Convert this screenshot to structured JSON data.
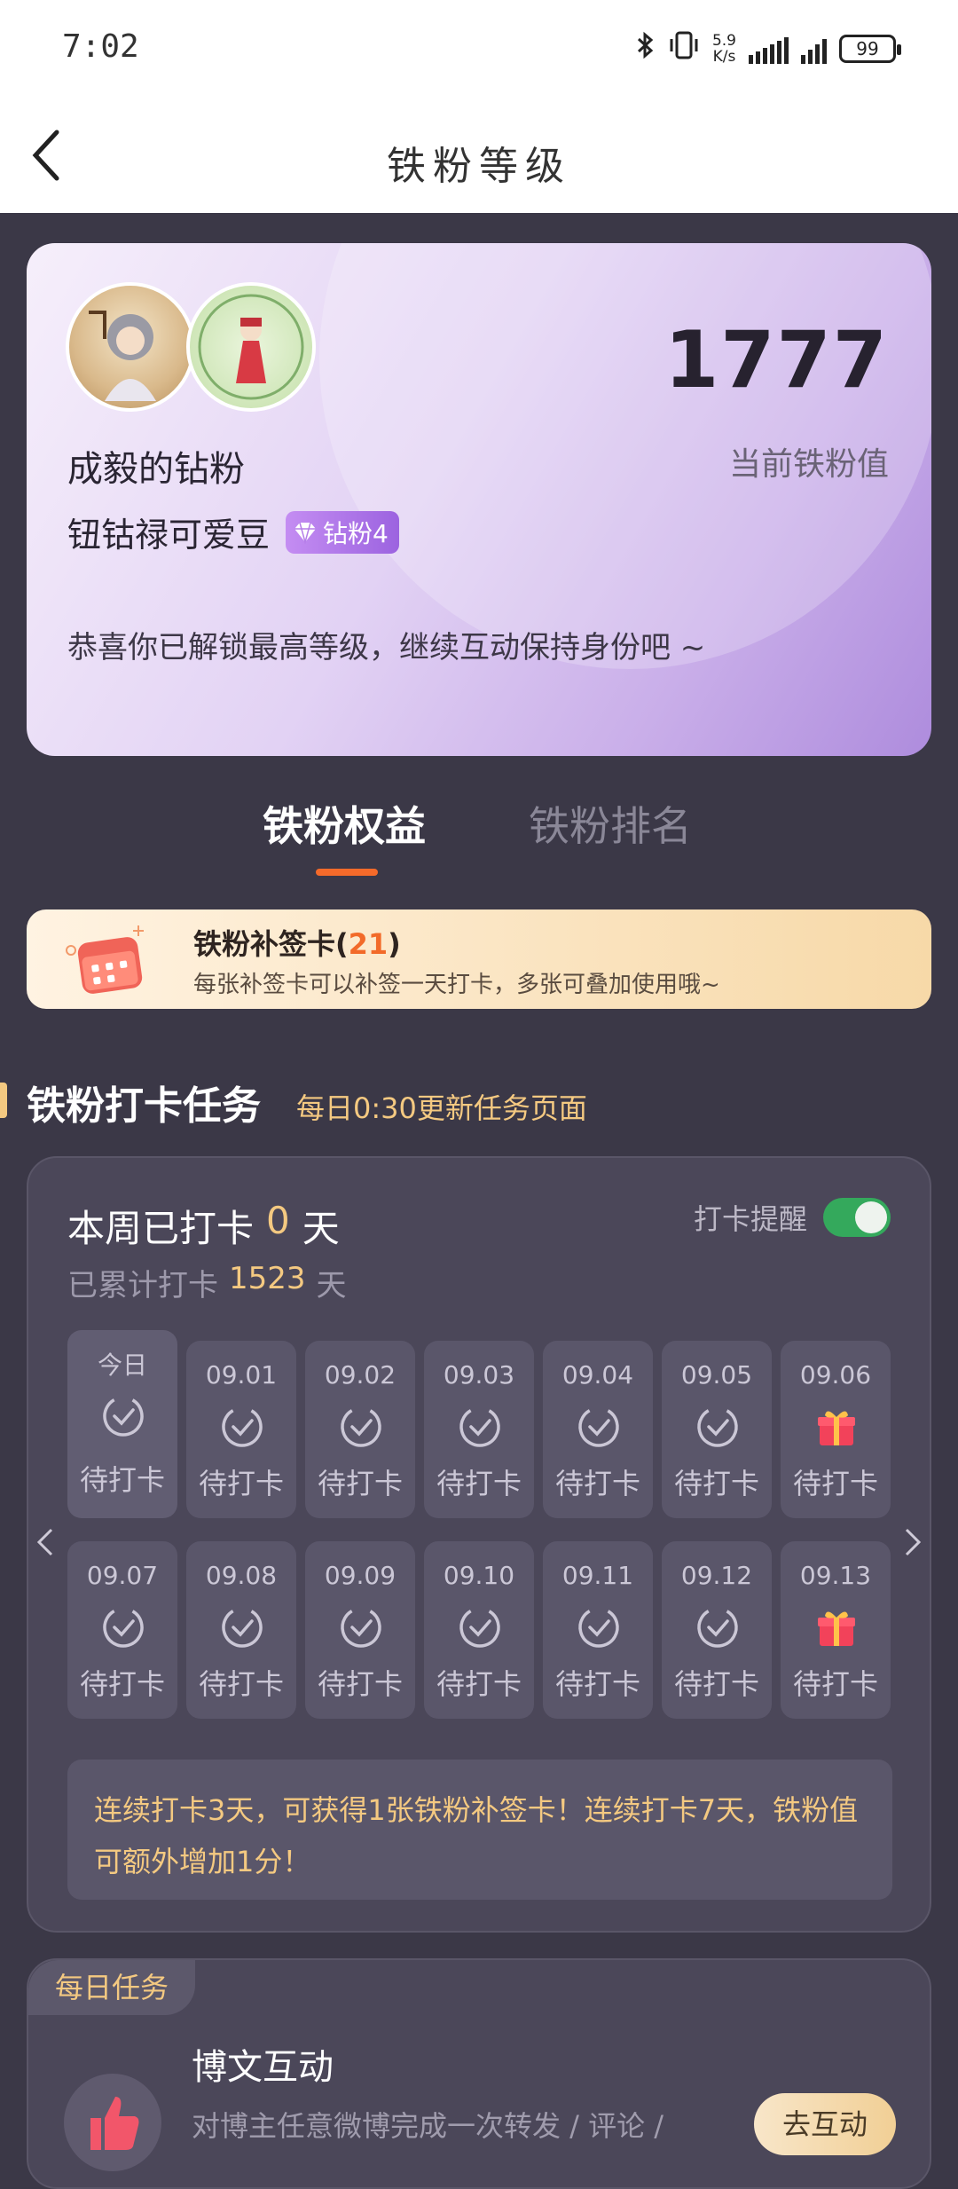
{
  "status_bar": {
    "time": "7:02",
    "net_speed_value": "5.9",
    "net_speed_unit": "K/s",
    "battery": "99"
  },
  "nav": {
    "title": "铁粉等级"
  },
  "profile": {
    "fan_group": "成毅的钻粉",
    "user_name": "钮钴禄可爱豆",
    "badge_label": "钻粉4",
    "score": "1777",
    "score_label": "当前铁粉值",
    "congrats": "恭喜你已解锁最高等级，继续互动保持身份吧 ~"
  },
  "tabs": [
    {
      "label": "铁粉权益",
      "active": true
    },
    {
      "label": "铁粉排名",
      "active": false
    }
  ],
  "makeup_card": {
    "title": "铁粉补签卡",
    "count": "21",
    "description": "每张补签卡可以补签一天打卡，多张可叠加使用哦~"
  },
  "checkin_section": {
    "title": "铁粉打卡任务",
    "subtitle": "每日0:30更新任务页面"
  },
  "checkin": {
    "week_prefix": "本周已打卡",
    "week_count": "0",
    "week_suffix": "天",
    "total_prefix": "已累计打卡",
    "total_count": "1523",
    "total_suffix": "天",
    "remind_label": "打卡提醒",
    "remind_on": true,
    "days": [
      {
        "date": "今日",
        "status": "待打卡",
        "icon": "check-icon"
      },
      {
        "date": "09.01",
        "status": "待打卡",
        "icon": "check-icon"
      },
      {
        "date": "09.02",
        "status": "待打卡",
        "icon": "check-icon"
      },
      {
        "date": "09.03",
        "status": "待打卡",
        "icon": "check-icon"
      },
      {
        "date": "09.04",
        "status": "待打卡",
        "icon": "check-icon"
      },
      {
        "date": "09.05",
        "status": "待打卡",
        "icon": "check-icon"
      },
      {
        "date": "09.06",
        "status": "待打卡",
        "icon": "gift-icon"
      },
      {
        "date": "09.07",
        "status": "待打卡",
        "icon": "check-icon"
      },
      {
        "date": "09.08",
        "status": "待打卡",
        "icon": "check-icon"
      },
      {
        "date": "09.09",
        "status": "待打卡",
        "icon": "check-icon"
      },
      {
        "date": "09.10",
        "status": "待打卡",
        "icon": "check-icon"
      },
      {
        "date": "09.11",
        "status": "待打卡",
        "icon": "check-icon"
      },
      {
        "date": "09.12",
        "status": "待打卡",
        "icon": "check-icon"
      },
      {
        "date": "09.13",
        "status": "待打卡",
        "icon": "gift-icon"
      }
    ],
    "tip": "连续打卡3天，可获得1张铁粉补签卡！连续打卡7天，铁粉值可额外增加1分！"
  },
  "daily_task": {
    "tag": "每日任务",
    "title": "博文互动",
    "description": "对博主任意微博完成一次转发 / 评论 /",
    "button_label": "去互动"
  },
  "colors": {
    "accent_orange": "#f56a2a",
    "gold": "#f4c981",
    "background": "#3b3847",
    "card": "#4b4759",
    "toggle_on": "#34a95c"
  }
}
